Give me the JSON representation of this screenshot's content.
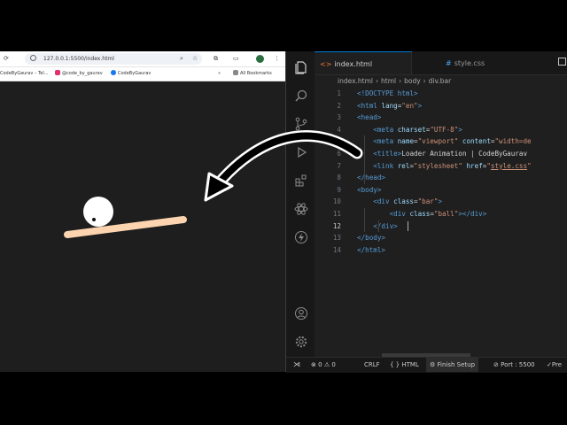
{
  "browser": {
    "url": "127.0.0.1:5500/index.html",
    "bookmarks": [
      {
        "label": "CodeByGaurav – Tel...",
        "color": "#2aa0dc"
      },
      {
        "label": "@code_by_gaurav",
        "color": "#e1306c"
      },
      {
        "label": "CodeByGaurav",
        "color": "#1877f2"
      }
    ],
    "overflow": "»",
    "all_bookmarks": "All Bookmarks"
  },
  "editor": {
    "tabs": [
      {
        "label": "index.html"
      },
      {
        "label": "style.css"
      }
    ],
    "breadcrumb": [
      "index.html",
      "html",
      "body",
      "div.bar"
    ],
    "current_line": 12,
    "lines": [
      {
        "n": "1",
        "tokens": [
          {
            "c": "t",
            "v": "<!DOCTYPE html>"
          }
        ]
      },
      {
        "n": "2",
        "tokens": [
          {
            "c": "t",
            "v": "<html"
          },
          {
            "c": "a",
            "v": " lang"
          },
          {
            "c": "tx",
            "v": "="
          },
          {
            "c": "s",
            "v": "\"en\""
          },
          {
            "c": "t",
            "v": ">"
          }
        ]
      },
      {
        "n": "3",
        "tokens": [
          {
            "c": "t",
            "v": "<head>"
          }
        ]
      },
      {
        "n": "4",
        "tokens": [
          {
            "c": "t",
            "v": "    <meta"
          },
          {
            "c": "a",
            "v": " charset"
          },
          {
            "c": "tx",
            "v": "="
          },
          {
            "c": "s",
            "v": "\"UTF-8\""
          },
          {
            "c": "t",
            "v": ">"
          }
        ]
      },
      {
        "n": "5",
        "tokens": [
          {
            "c": "t",
            "v": "    <meta"
          },
          {
            "c": "a",
            "v": " name"
          },
          {
            "c": "tx",
            "v": "="
          },
          {
            "c": "s",
            "v": "\"viewport\""
          },
          {
            "c": "a",
            "v": " content"
          },
          {
            "c": "tx",
            "v": "="
          },
          {
            "c": "s",
            "v": "\"width=de"
          }
        ]
      },
      {
        "n": "6",
        "tokens": [
          {
            "c": "t",
            "v": "    <title>"
          },
          {
            "c": "tx",
            "v": "Loader Animation | CodeByGaurav"
          }
        ]
      },
      {
        "n": "7",
        "tokens": [
          {
            "c": "t",
            "v": "    <link"
          },
          {
            "c": "a",
            "v": " rel"
          },
          {
            "c": "tx",
            "v": "="
          },
          {
            "c": "s",
            "v": "\"stylesheet\""
          },
          {
            "c": "a",
            "v": " href"
          },
          {
            "c": "tx",
            "v": "="
          },
          {
            "c": "s",
            "v": "\""
          },
          {
            "c": "su",
            "v": "style.css"
          },
          {
            "c": "s",
            "v": "\""
          }
        ]
      },
      {
        "n": "8",
        "tokens": [
          {
            "c": "t",
            "v": "</head>"
          }
        ]
      },
      {
        "n": "9",
        "tokens": [
          {
            "c": "t",
            "v": "<body>"
          }
        ]
      },
      {
        "n": "10",
        "tokens": [
          {
            "c": "t",
            "v": "    <div"
          },
          {
            "c": "a",
            "v": " class"
          },
          {
            "c": "tx",
            "v": "="
          },
          {
            "c": "s",
            "v": "\"bar\""
          },
          {
            "c": "t",
            "v": ">"
          }
        ]
      },
      {
        "n": "11",
        "tokens": [
          {
            "c": "t",
            "v": "        <div"
          },
          {
            "c": "a",
            "v": " class"
          },
          {
            "c": "tx",
            "v": "="
          },
          {
            "c": "s",
            "v": "\"ball\""
          },
          {
            "c": "t",
            "v": "></div>"
          }
        ]
      },
      {
        "n": "12",
        "tokens": [
          {
            "c": "t",
            "v": "    </div>"
          }
        ]
      },
      {
        "n": "13",
        "tokens": [
          {
            "c": "t",
            "v": "</body>"
          }
        ]
      },
      {
        "n": "14",
        "tokens": [
          {
            "c": "t",
            "v": "</html>"
          }
        ]
      }
    ]
  },
  "status": {
    "problems": "0",
    "warnings": "0",
    "eol": "CRLF",
    "language": "HTML",
    "setup": "Finish Setup",
    "port": "Port : 5500",
    "prettier": "Pre"
  },
  "colors": {
    "bar": "#fcd5b0",
    "ball": "#ffffff",
    "accent": "#0078d4"
  }
}
